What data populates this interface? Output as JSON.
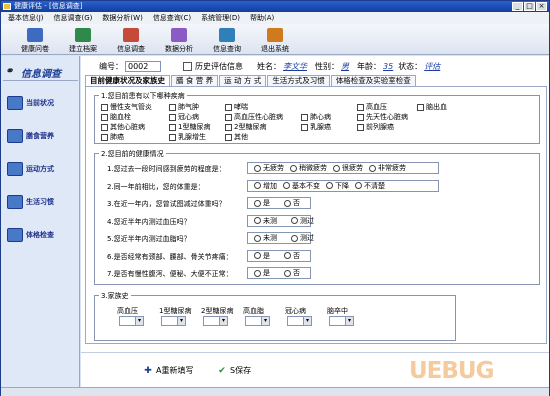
{
  "window": {
    "title": "健康评估 - [信息调查]"
  },
  "menu": [
    "基本信息(J)",
    "信息调查(G)",
    "数据分析(W)",
    "信息查询(C)",
    "系统管理(D)",
    "帮助(A)"
  ],
  "toolbar": [
    {
      "label": "健康问卷",
      "color": "#3d6bc2"
    },
    {
      "label": "建立档案",
      "color": "#2f8a4a"
    },
    {
      "label": "信息调查",
      "color": "#c64a3a"
    },
    {
      "label": "数据分析",
      "color": "#8a5bc2"
    },
    {
      "label": "信息查询",
      "color": "#2f7fb8"
    },
    {
      "label": "退出系统",
      "color": "#d07a1e"
    }
  ],
  "sidebar": {
    "title": "信息调查",
    "items": [
      "当前状况",
      "膳食营养",
      "运动方式",
      "生活习惯",
      "体格检查"
    ]
  },
  "record": {
    "id_label": "编号：",
    "id_value": "0002",
    "history_label": "历史评估信息",
    "name_label": "姓名：",
    "name_value": "李文华",
    "sex_label": "性别：",
    "sex_value": "男",
    "age_label": "年龄：",
    "age_value": "35",
    "status_label": "状态：",
    "status_value": "评估"
  },
  "tabs": [
    "目前健康状况及家族史",
    "膳 食 营 养",
    "运 动 方 式",
    "生活方式及习惯",
    "体格检查及实验室检查"
  ],
  "q1": {
    "title": "1.您目前患有以下哪种疾病",
    "diseases": [
      "慢性支气管炎",
      "肺气肿",
      "哮喘",
      "",
      "高血压",
      "脑出血",
      "脑血栓",
      "冠心病",
      "高血压性心脏病",
      "肺心病",
      "先天性心脏病",
      "",
      "其他心脏病",
      "1型糖尿病",
      "2型糖尿病",
      "乳腺癌",
      "前列腺癌",
      "",
      "肺癌",
      "乳腺增生",
      "其他",
      "",
      "",
      ""
    ]
  },
  "q2": {
    "title": "2.您目前的健康情况",
    "questions": [
      {
        "text": "1.您过去一段时间感到疲劳的程度是：",
        "options": [
          "无疲劳",
          "稍微疲劳",
          "很疲劳",
          "非常疲劳"
        ]
      },
      {
        "text": "2.同一年前相比，您的体重是：",
        "options": [
          "增加",
          "基本不变",
          "下降",
          "不清楚"
        ]
      },
      {
        "text": "3.在近一年内，您曾试图减过体重吗？",
        "options": [
          "是",
          "否"
        ]
      },
      {
        "text": "4.您近半年内测过血压吗？",
        "options": [
          "未测",
          "测过"
        ]
      },
      {
        "text": "5.您近半年内测过血脂吗？",
        "options": [
          "未测",
          "测过"
        ]
      },
      {
        "text": "6.是否经常有颈部、腰部、骨关节疼痛：",
        "options": [
          "是",
          "否"
        ]
      },
      {
        "text": "7.是否有慢性腹泻、便秘、大便不正常：",
        "options": [
          "是",
          "否"
        ]
      }
    ]
  },
  "q3": {
    "title": "3.家族史",
    "columns": [
      "高血压",
      "1型糖尿病",
      "2型糖尿病",
      "高血脂",
      "冠心病",
      "脑卒中"
    ]
  },
  "actions": {
    "reset": "A重新填写",
    "save": "S保存"
  },
  "watermark": "UEBUG"
}
